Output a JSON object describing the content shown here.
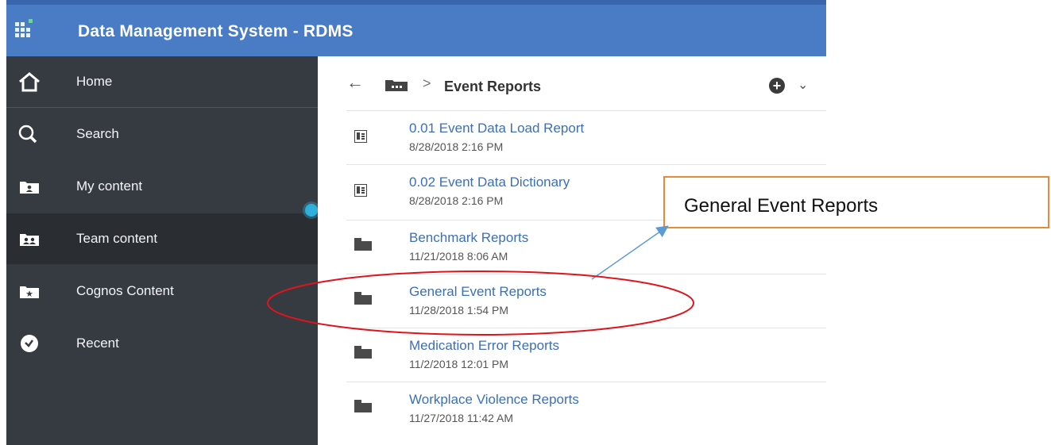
{
  "app": {
    "title": "Data Management System - RDMS"
  },
  "sidebar": {
    "items": [
      {
        "label": "Home",
        "icon": "home-icon"
      },
      {
        "label": "Search",
        "icon": "search-icon"
      },
      {
        "label": "My content",
        "icon": "my-content-icon"
      },
      {
        "label": "Team content",
        "icon": "team-content-icon",
        "active": true
      },
      {
        "label": "Cognos Content",
        "icon": "star-folder-icon"
      },
      {
        "label": "Recent",
        "icon": "clock-icon"
      }
    ]
  },
  "breadcrumb": {
    "current": "Event Reports",
    "separator": ">"
  },
  "list": [
    {
      "name": "0.01 Event Data Load Report",
      "date": "8/28/2018 2:16 PM",
      "type": "report"
    },
    {
      "name": "0.02 Event Data Dictionary",
      "date": "8/28/2018 2:16 PM",
      "type": "report"
    },
    {
      "name": "Benchmark Reports",
      "date": "11/21/2018 8:06 AM",
      "type": "folder"
    },
    {
      "name": "General Event Reports",
      "date": "11/28/2018 1:54 PM",
      "type": "folder"
    },
    {
      "name": "Medication Error Reports",
      "date": "11/2/2018 12:01 PM",
      "type": "folder"
    },
    {
      "name": "Workplace Violence Reports",
      "date": "11/27/2018 11:42 AM",
      "type": "folder"
    }
  ],
  "annotation": {
    "callout_text": "General Event Reports"
  },
  "colors": {
    "header": "#4a7cc6",
    "sidebar": "#363b41",
    "link": "#3c6fb5",
    "callout_border": "#e58a38",
    "highlight_ellipse": "#e0141c",
    "arrow": "#5b9bd5"
  }
}
